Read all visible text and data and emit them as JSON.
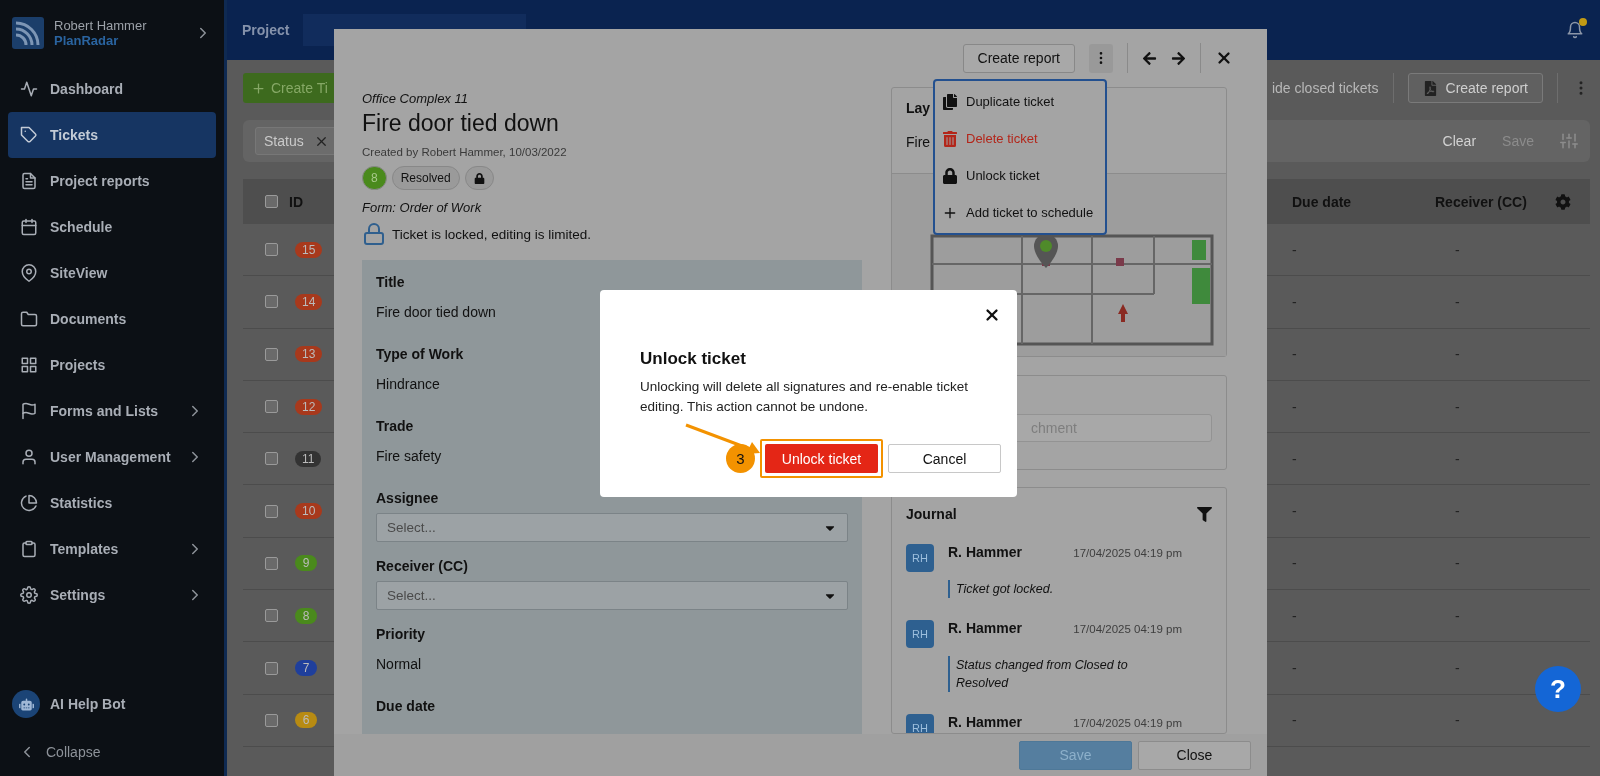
{
  "sidebar": {
    "user": "Robert Hammer",
    "brand": "PlanRadar",
    "items": [
      {
        "label": "Dashboard",
        "selected": false,
        "expandable": false
      },
      {
        "label": "Tickets",
        "selected": true,
        "expandable": false
      },
      {
        "label": "Project reports",
        "selected": false,
        "expandable": false
      },
      {
        "label": "Schedule",
        "selected": false,
        "expandable": false
      },
      {
        "label": "SiteView",
        "selected": false,
        "expandable": false
      },
      {
        "label": "Documents",
        "selected": false,
        "expandable": false
      },
      {
        "label": "Projects",
        "selected": false,
        "expandable": false
      },
      {
        "label": "Forms and Lists",
        "selected": false,
        "expandable": true
      },
      {
        "label": "User Management",
        "selected": false,
        "expandable": true
      },
      {
        "label": "Statistics",
        "selected": false,
        "expandable": false
      },
      {
        "label": "Templates",
        "selected": false,
        "expandable": true
      },
      {
        "label": "Settings",
        "selected": false,
        "expandable": true
      }
    ],
    "help_bot": "AI Help Bot",
    "collapse": "Collapse"
  },
  "topbar": {
    "project_label": "Project",
    "notification": true
  },
  "toolbar": {
    "create_button": "Create Ti",
    "hide_closed": "ide closed tickets",
    "create_report": "Create report"
  },
  "filter_bar": {
    "chip": "Status",
    "clear": "Clear",
    "save": "Save"
  },
  "table": {
    "columns": [
      "ID",
      "Due date",
      "Receiver (CC)"
    ],
    "select_all_checked": false,
    "rows": [
      {
        "id": "15",
        "color": "#a8391c",
        "checked": false,
        "due_date": "-",
        "receiver": "-"
      },
      {
        "id": "14",
        "color": "#a8391c",
        "checked": false,
        "due_date": "-",
        "receiver": "-"
      },
      {
        "id": "13",
        "color": "#a8391c",
        "checked": false,
        "due_date": "-",
        "receiver": "-"
      },
      {
        "id": "12",
        "color": "#a8391c",
        "checked": false,
        "due_date": "-",
        "receiver": "-"
      },
      {
        "id": "11",
        "color": "#333333",
        "checked": false,
        "due_date": "-",
        "receiver": "-"
      },
      {
        "id": "10",
        "color": "#a8391c",
        "checked": false,
        "due_date": "-",
        "receiver": "-"
      },
      {
        "id": "9",
        "color": "#4a8a1c",
        "checked": false,
        "due_date": "-",
        "receiver": "-"
      },
      {
        "id": "8",
        "color": "#4a8a1c",
        "checked": false,
        "due_date": "-",
        "receiver": "-"
      },
      {
        "id": "7",
        "color": "#1f3f9c",
        "checked": false,
        "due_date": "-",
        "receiver": "-"
      },
      {
        "id": "6",
        "color": "#b88b12",
        "checked": false,
        "due_date": "-",
        "receiver": "-"
      }
    ]
  },
  "ticket": {
    "create_report": "Create report",
    "project": "Office Complex 11",
    "title": "Fire door tied down",
    "created": "Created by Robert Hammer, 10/03/2022",
    "id_badge": "8",
    "status": "Resolved",
    "locked": true,
    "form": "Form: Order of Work",
    "lock_notice": "Ticket is locked, editing is limited.",
    "fields": [
      {
        "label": "Title",
        "kind": "text",
        "value": "Fire door tied down"
      },
      {
        "label": "Type of Work",
        "kind": "text",
        "value": "Hindrance"
      },
      {
        "label": "Trade",
        "kind": "text",
        "value": "Fire safety"
      },
      {
        "label": "Assignee",
        "kind": "select",
        "placeholder": "Select..."
      },
      {
        "label": "Receiver (CC)",
        "kind": "select",
        "placeholder": "Select..."
      },
      {
        "label": "Priority",
        "kind": "text",
        "value": "Normal"
      },
      {
        "label": "Due date",
        "kind": "label"
      }
    ],
    "layer_label": "Lay",
    "layer_value": "Fire",
    "attachment_placeholder": "chment",
    "journal": {
      "title": "Journal",
      "entries": [
        {
          "avatar": "RH",
          "name": "R. Hammer",
          "date": "17/04/2025 04:19 pm",
          "text": "Ticket got locked."
        },
        {
          "avatar": "RH",
          "name": "R. Hammer",
          "date": "17/04/2025 04:19 pm",
          "text": "Status changed from Closed to Resolved"
        },
        {
          "avatar": "RH",
          "name": "R. Hammer",
          "date": "17/04/2025 04:19 pm"
        }
      ]
    },
    "save": "Save",
    "close": "Close"
  },
  "menu": {
    "items": [
      {
        "label": "Duplicate ticket",
        "kind": "duplicate",
        "danger": false
      },
      {
        "label": "Delete ticket",
        "kind": "delete",
        "danger": true
      },
      {
        "label": "Unlock ticket",
        "kind": "lock",
        "danger": false
      },
      {
        "label": "Add ticket to schedule",
        "kind": "add",
        "danger": false
      }
    ]
  },
  "dialog": {
    "title": "Unlock ticket",
    "message": "Unlocking will delete all signatures and re-enable ticket editing. This action cannot be undone.",
    "step": "3",
    "confirm": "Unlock ticket",
    "confirm_highlighted": true,
    "cancel": "Cancel"
  },
  "help_button": "?"
}
